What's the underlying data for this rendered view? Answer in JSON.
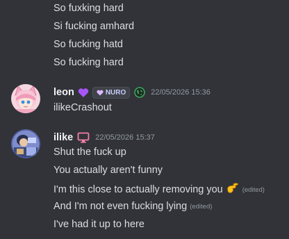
{
  "messages_top": [
    "So fuxking hard",
    "Si fucking amhard",
    "So fucking hatd",
    "So fucking hard"
  ],
  "leon": {
    "username": "leon",
    "tag_label": "NURO",
    "timestamp": "22/05/2026 15:36",
    "message": "ilikeCrashout",
    "heart_color": "#a855f7",
    "globe_color": "#3ba55c"
  },
  "ilike": {
    "username": "ilike",
    "timestamp": "22/05/2026 15:37",
    "device_color": "#f47fa7",
    "messages": {
      "m1": "Shut the fuck up",
      "m2": "You actually aren't funny",
      "m3": "I'm this close to actually removing you",
      "m4": "And I'm not even fucking lying",
      "m5": "I've had it up to here"
    },
    "edited_label": "(edited)",
    "emoji": "pinching-hand-emoji"
  }
}
